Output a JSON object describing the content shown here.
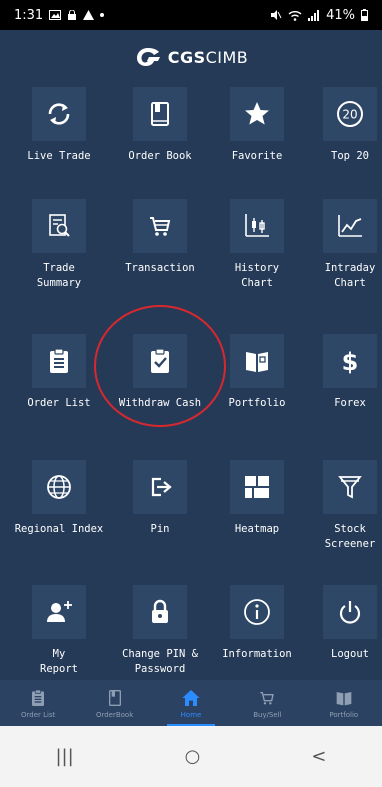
{
  "status_bar": {
    "time": "1:31",
    "battery": "41%",
    "notification_icons": [
      "image-icon",
      "lock-icon",
      "warning-icon",
      "dot-icon"
    ],
    "system_icons": [
      "mute-icon",
      "wifi-icon",
      "signal-icon",
      "battery-icon"
    ]
  },
  "header": {
    "brand_bold": "CGS",
    "brand_light": "CIMB",
    "icon": "cgs-logo-icon"
  },
  "grid": [
    {
      "label": "Live Trade",
      "icon": "refresh-icon"
    },
    {
      "label": "Order Book",
      "icon": "book-icon"
    },
    {
      "label": "Favorite",
      "icon": "star-icon"
    },
    {
      "label": "Top 20",
      "icon": "top20-icon"
    },
    {
      "label": "Trade\nSummary",
      "icon": "report-search-icon"
    },
    {
      "label": "Transaction",
      "icon": "cart-icon"
    },
    {
      "label": "History\nChart",
      "icon": "candlestick-icon"
    },
    {
      "label": "Intraday\nChart",
      "icon": "line-chart-icon"
    },
    {
      "label": "Order List",
      "icon": "clipboard-list-icon"
    },
    {
      "label": "Withdraw Cash",
      "icon": "clipboard-check-icon"
    },
    {
      "label": "Portfolio",
      "icon": "open-book-icon"
    },
    {
      "label": "Forex",
      "icon": "dollar-icon"
    },
    {
      "label": "Regional Index",
      "icon": "globe-icon"
    },
    {
      "label": "Pin",
      "icon": "pin-arrow-icon"
    },
    {
      "label": "Heatmap",
      "icon": "heatmap-icon"
    },
    {
      "label": "Stock\nScreener",
      "icon": "filter-icon"
    },
    {
      "label": "My\nReport",
      "icon": "add-user-icon"
    },
    {
      "label": "Change PIN &\nPassword",
      "icon": "padlock-icon"
    },
    {
      "label": "Information",
      "icon": "info-icon"
    },
    {
      "label": "Logout",
      "icon": "power-icon"
    }
  ],
  "highlighted_item": "Withdraw Cash",
  "bottom_nav": [
    {
      "label": "Order List",
      "icon": "clipboard-list-icon",
      "active": false
    },
    {
      "label": "OrderBook",
      "icon": "book-icon",
      "active": false
    },
    {
      "label": "Home",
      "icon": "home-icon",
      "active": true
    },
    {
      "label": "Buy/Sell",
      "icon": "cart-icon",
      "active": false
    },
    {
      "label": "Portfolio",
      "icon": "open-book-icon",
      "active": false
    }
  ],
  "android_nav": {
    "recent": "|||",
    "home": "○",
    "back": "<"
  },
  "colors": {
    "background": "#253a57",
    "tile": "#2e4766",
    "accent": "#2b8cff",
    "highlight": "#d8282f"
  }
}
